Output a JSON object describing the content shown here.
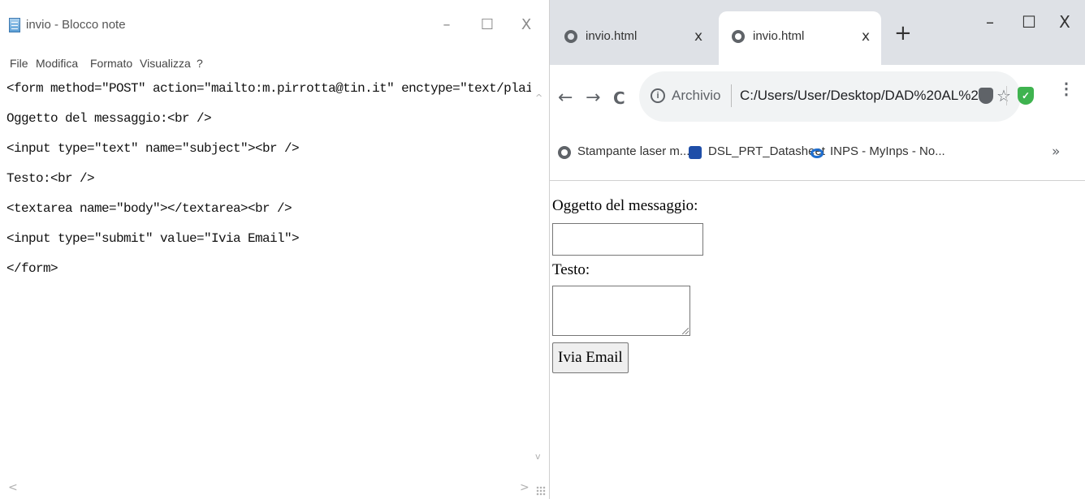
{
  "notepad": {
    "title": "invio - Blocco note",
    "window_controls": {
      "minimize": "–",
      "maximize": "☐",
      "close": "X"
    },
    "menu": [
      "File",
      "Modifica",
      "Formato",
      "Visualizza",
      "?"
    ],
    "lines": [
      "<form method=\"POST\" action=\"mailto:m.pirrotta@tin.it\" enctype=\"text/plain\">",
      "Oggetto del messaggio:<br />",
      "<input type=\"text\" name=\"subject\"><br />",
      "Testo:<br />",
      "<textarea name=\"body\"></textarea><br />",
      "<input type=\"submit\" value=\"Ivia Email\">",
      "</form>"
    ],
    "scroll_up": "^",
    "scroll_down": "v",
    "scroll_left": "<",
    "scroll_right": ">"
  },
  "browser": {
    "tabs": [
      {
        "label": "invio.html",
        "close": "x",
        "active": false
      },
      {
        "label": "invio.html",
        "close": "x",
        "active": true
      }
    ],
    "new_tab": "+",
    "window_controls": {
      "minimize": "–",
      "maximize": "☐",
      "close": "X"
    },
    "nav": {
      "back": "←",
      "forward": "→",
      "reload": "C"
    },
    "address": {
      "info_icon": "i",
      "scheme_label": "Archivio",
      "url": "C:/Users/User/Desktop/DAD%20AL%2...",
      "star": "☆"
    },
    "extension_check": "✓",
    "menu_dots": "⋮",
    "bookmarks": [
      {
        "label": "Stampante laser m...",
        "icon": "globe-icon"
      },
      {
        "label": "DSL_PRT_Datasheet",
        "icon": "brother-icon"
      },
      {
        "label": "INPS - MyInps - No...",
        "icon": "inps-icon"
      }
    ],
    "bookmarks_more": "»"
  },
  "page": {
    "subject_label": "Oggetto del messaggio:",
    "subject_value": "",
    "body_label": "Testo:",
    "body_value": "",
    "submit_label": "Ivia Email"
  }
}
